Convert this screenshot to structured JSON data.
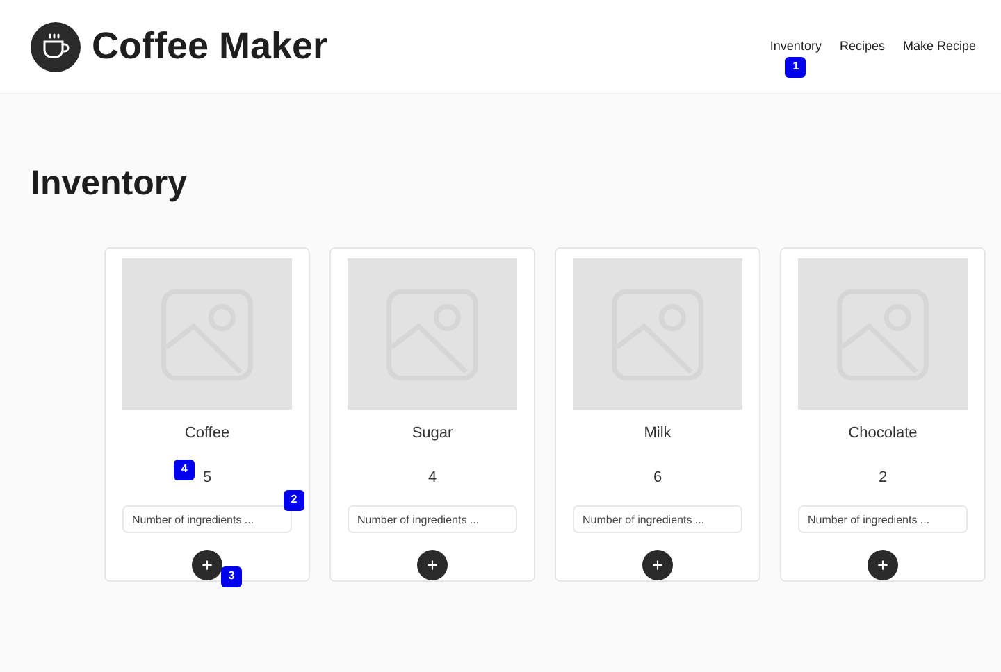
{
  "header": {
    "title": "Coffee Maker",
    "nav": [
      {
        "label": "Inventory",
        "marker": "1"
      },
      {
        "label": "Recipes"
      },
      {
        "label": "Make Recipe"
      }
    ]
  },
  "page_title": "Inventory",
  "items": [
    {
      "name": "Coffee",
      "count": "5",
      "placeholder": "Number of ingredients ...",
      "count_marker": "4",
      "input_marker": "2",
      "button_marker": "3"
    },
    {
      "name": "Sugar",
      "count": "4",
      "placeholder": "Number of ingredients ..."
    },
    {
      "name": "Milk",
      "count": "6",
      "placeholder": "Number of ingredients ..."
    },
    {
      "name": "Chocolate",
      "count": "2",
      "placeholder": "Number of ingredients ..."
    }
  ]
}
